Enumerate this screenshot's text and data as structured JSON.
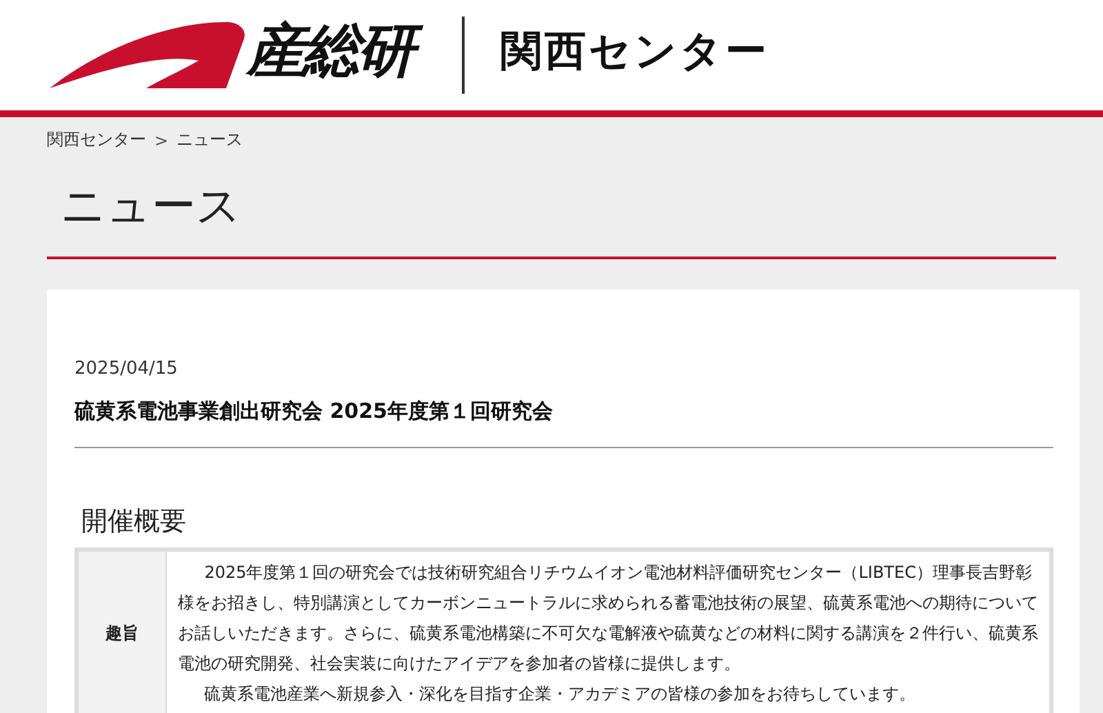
{
  "header": {
    "logo_text": "産総研",
    "site_title": "関西センター"
  },
  "breadcrumb": {
    "items": [
      "関西センター",
      "ニュース"
    ],
    "separator": ">"
  },
  "page_title": "ニュース",
  "article": {
    "date": "2025/04/15",
    "title": "硫黄系電池事業創出研究会 2025年度第１回研究会",
    "section_heading": "開催概要",
    "table": [
      {
        "label": "趣旨",
        "paragraphs": [
          "2025年度第１回の研究会では技術研究組合リチウムイオン電池材料評価研究センター（LIBTEC）理事長吉野彰様をお招きし、特別講演としてカーボンニュートラルに求められる蓄電池技術の展望、硫黄系電池への期待についてお話しいただきます。さらに、硫黄系電池構築に不可欠な電解液や硫黄などの材料に関する講演を２件行い、硫黄系電池の研究開発、社会実装に向けたアイデアを参加者の皆様に提供します。",
          "硫黄系電池産業へ新規参入・深化を目指す企業・アカデミアの皆様の参加をお待ちしています。"
        ]
      }
    ]
  }
}
